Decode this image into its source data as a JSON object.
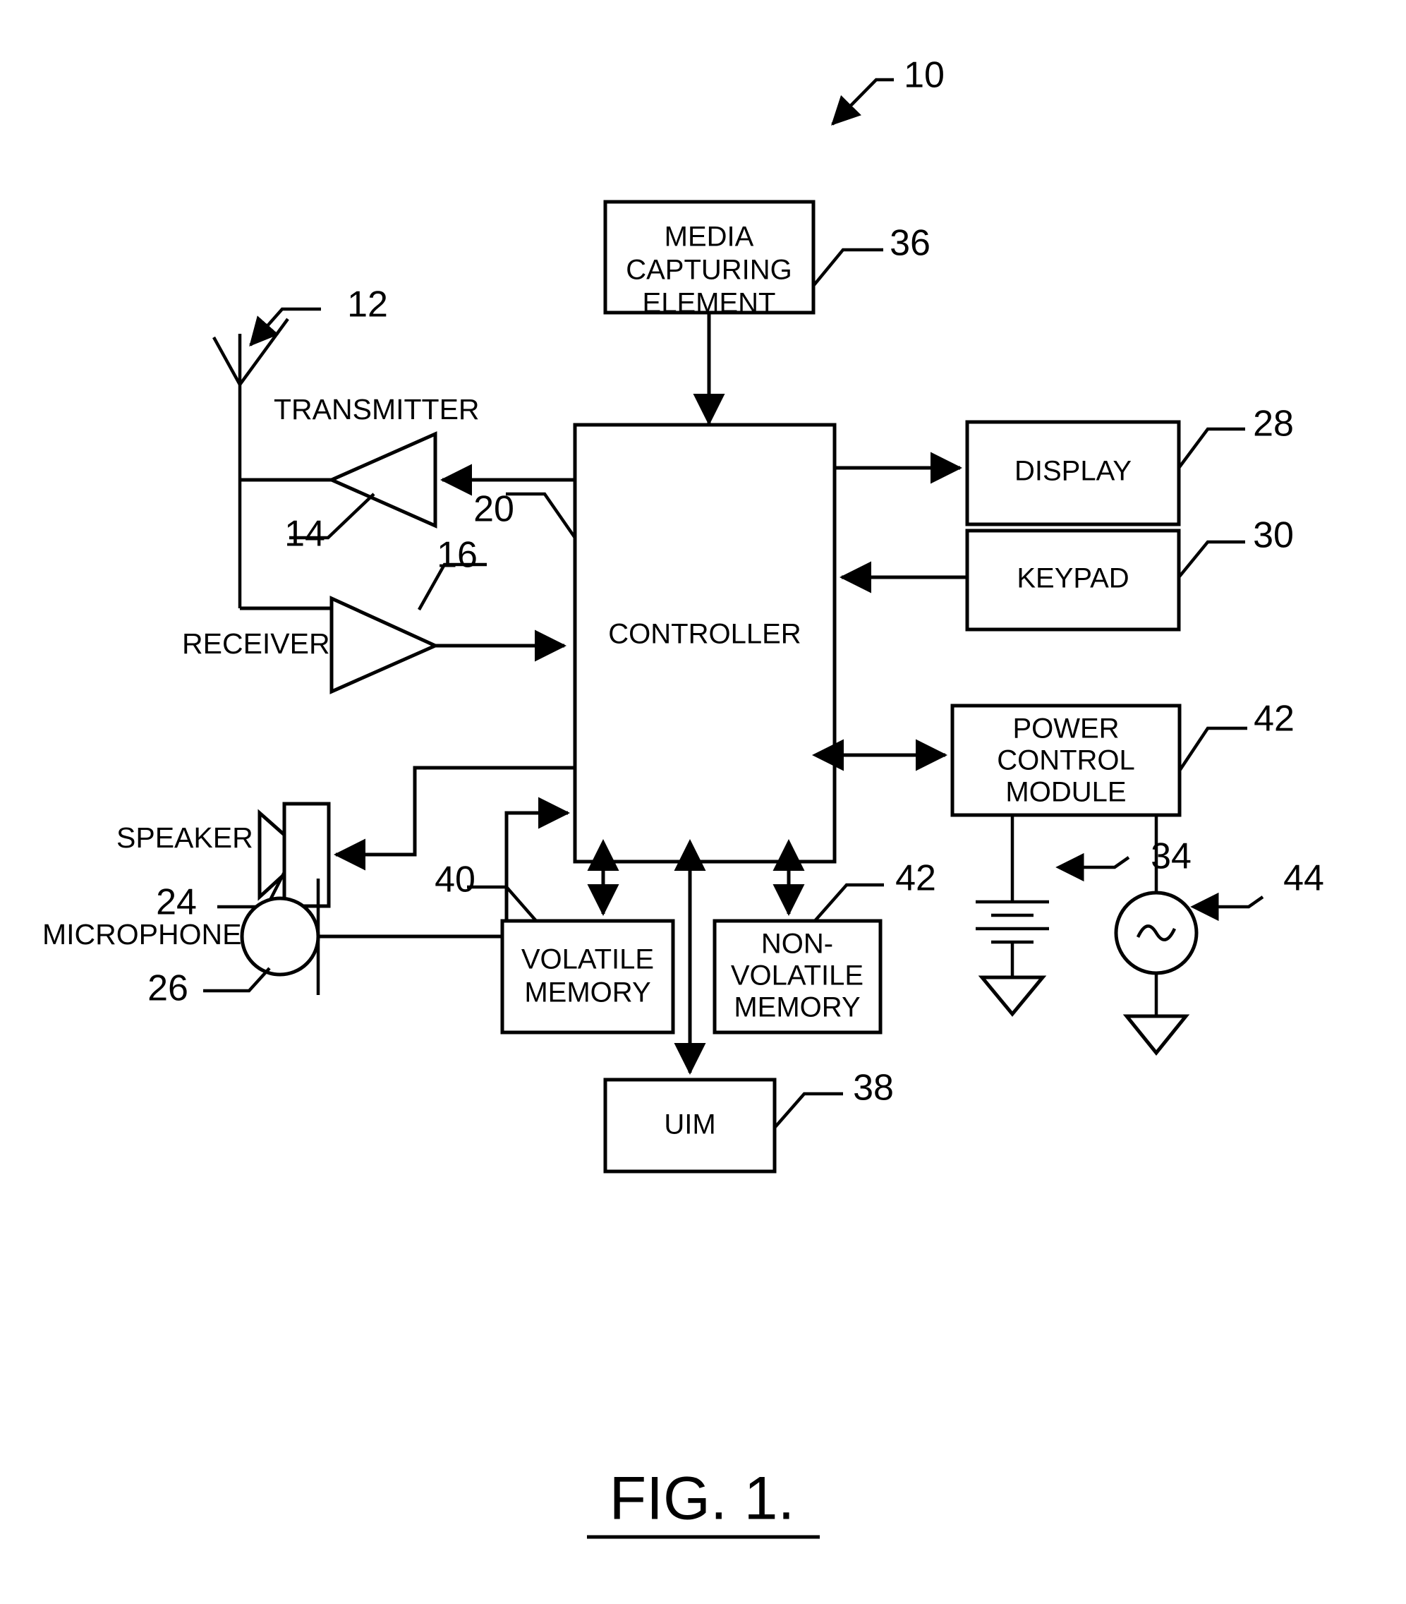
{
  "figure": {
    "caption": "FIG. 1.",
    "overall_ref": "10"
  },
  "blocks": {
    "media_capturing_element": {
      "label_line1": "MEDIA",
      "label_line2": "CAPTURING",
      "label_line3": "ELEMENT",
      "ref": "36"
    },
    "controller": {
      "label": "CONTROLLER",
      "ref": "20"
    },
    "display": {
      "label": "DISPLAY",
      "ref": "28"
    },
    "keypad": {
      "label": "KEYPAD",
      "ref": "30"
    },
    "power_control_module": {
      "label_line1": "POWER",
      "label_line2": "CONTROL",
      "label_line3": "MODULE",
      "ref": "42"
    },
    "volatile_memory": {
      "label_line1": "VOLATILE",
      "label_line2": "MEMORY",
      "ref": "40"
    },
    "non_volatile_memory": {
      "label_line1": "NON-",
      "label_line2": "VOLATILE",
      "label_line3": "MEMORY",
      "ref": "42"
    },
    "uim": {
      "label": "UIM",
      "ref": "38"
    }
  },
  "symbols": {
    "antenna": {
      "ref": "12"
    },
    "transmitter": {
      "label": "TRANSMITTER",
      "ref": "14"
    },
    "receiver": {
      "label": "RECEIVER",
      "ref": "16"
    },
    "speaker": {
      "label": "SPEAKER",
      "ref": "24"
    },
    "microphone": {
      "label": "MICROPHONE",
      "ref": "26"
    },
    "battery": {
      "ref": "34"
    },
    "ac_source": {
      "ref": "44"
    }
  },
  "colors": {
    "ink": "#000000",
    "paper": "#ffffff"
  }
}
